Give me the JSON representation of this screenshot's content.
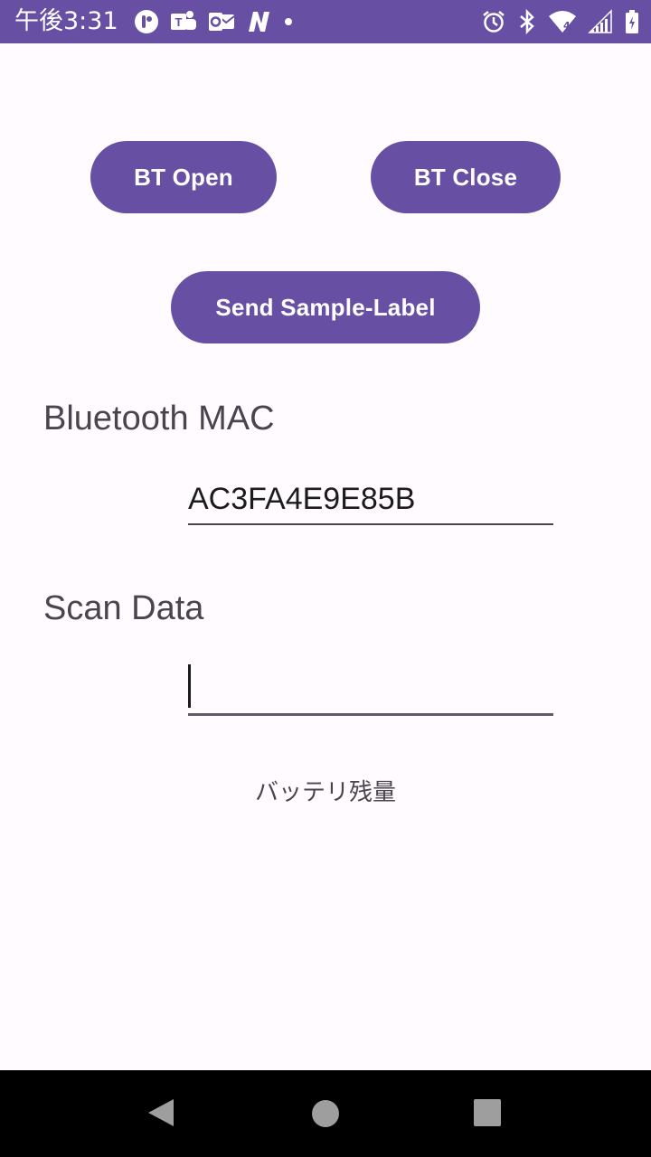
{
  "status_bar": {
    "time": "午後3:31",
    "icons_left": [
      "notification-app-icon",
      "teams-icon",
      "outlook-icon",
      "n-app-icon",
      "more-dot-icon"
    ],
    "icons_right": [
      "alarm-icon",
      "bluetooth-icon",
      "wifi-icon",
      "signal-icon",
      "battery-icon"
    ],
    "wifi_badge": "4",
    "background": "#6750A4"
  },
  "buttons": {
    "bt_open": "BT Open",
    "bt_close": "BT Close",
    "send_sample": "Send Sample-Label"
  },
  "fields": {
    "mac_label": "Bluetooth MAC",
    "mac_value": "AC3FA4E9E85B",
    "scan_label": "Scan Data",
    "scan_value": ""
  },
  "battery_label": "バッテリ残量",
  "nav_bar": {
    "buttons": [
      "back-icon",
      "home-icon",
      "recents-icon"
    ]
  },
  "colors": {
    "accent": "#6750A4",
    "background": "#FFFBFE",
    "text": "#49454F"
  }
}
